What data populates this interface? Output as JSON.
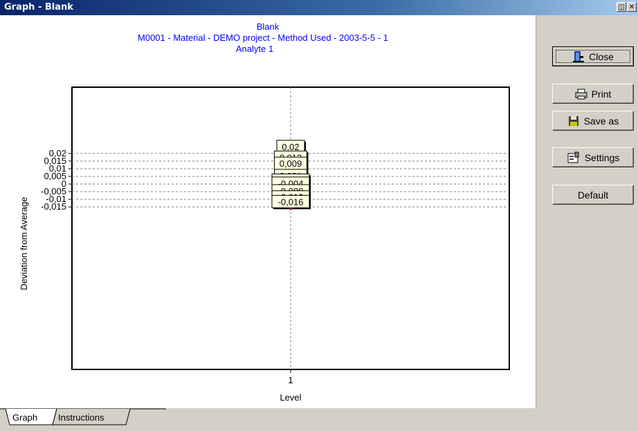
{
  "window": {
    "title": "Graph - Blank",
    "restore_symbol": "◫",
    "close_symbol": "✕"
  },
  "chart_data": {
    "type": "scatter",
    "title": "Blank",
    "subtitle": "M0001 - Material - DEMO project - Method Used - 2003-5-5 - 1",
    "series_title": "Analyte 1",
    "xlabel": "Level",
    "ylabel": "Deviation from Average",
    "categories": [
      "1"
    ],
    "ylim": [
      -0.016,
      0.021
    ],
    "yticks": [
      0.02,
      0.015,
      0.01,
      0.005,
      0,
      -0.005,
      -0.01,
      -0.015
    ],
    "ytick_labels": [
      "0,02",
      "0,015",
      "0,01",
      "0,005",
      "0",
      "-0,005",
      "-0,01",
      "-0,015"
    ],
    "points": [
      {
        "x": "1",
        "y": 0.02,
        "label": "0,02"
      },
      {
        "x": "1",
        "y": 0.013,
        "label": "0,013"
      },
      {
        "x": "1",
        "y": 0.009,
        "label": "0,009"
      },
      {
        "x": "1",
        "y": 0.001,
        "label": "0,001"
      },
      {
        "x": "1",
        "y": -0.002,
        "label": "-0,002"
      },
      {
        "x": "1",
        "y": -0.004,
        "label": "-0,004"
      },
      {
        "x": "1",
        "y": -0.009,
        "label": "-0,009"
      },
      {
        "x": "1",
        "y": -0.013,
        "label": "-0,013"
      },
      {
        "x": "1",
        "y": -0.016,
        "label": "-0,016"
      }
    ],
    "grid": true,
    "title_color": "#0000ff",
    "marker_color": "#c00000",
    "label_bg": "#ffffe1"
  },
  "buttons": {
    "close": "Close",
    "print": "Print",
    "save_as": "Save as",
    "settings": "Settings",
    "default": "Default"
  },
  "tabs": [
    {
      "label": "Graph",
      "active": true
    },
    {
      "label": "Instructions",
      "active": false
    }
  ]
}
